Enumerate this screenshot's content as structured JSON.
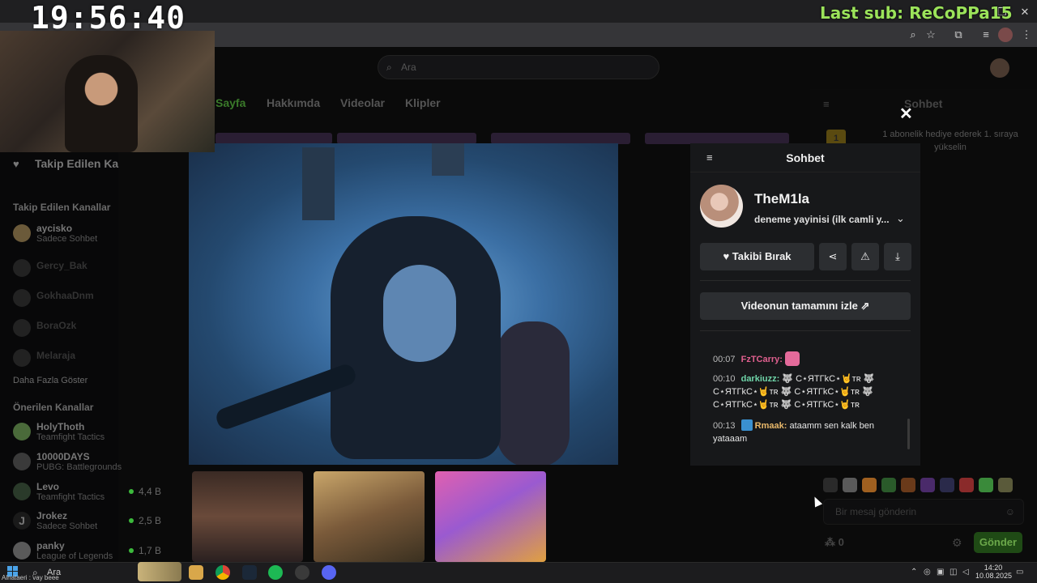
{
  "overlay": {
    "clock": "19:56:40",
    "last_sub": "Last sub: ReCoPPa15"
  },
  "site": {
    "search_placeholder": "Ara",
    "nav_tabs": [
      "Sayfa",
      "Hakkımda",
      "Videolar",
      "Klipler"
    ],
    "sidebar": {
      "title": "Takip Edilen Ka",
      "followed_header": "Takip Edilen Kanallar",
      "followed": [
        {
          "name": "aycisko",
          "sub": "Sadece Sohbet"
        },
        {
          "name": "Gercy_Bak",
          "sub": ""
        },
        {
          "name": "GokhaaDnm",
          "sub": ""
        },
        {
          "name": "BoraOzk",
          "sub": ""
        },
        {
          "name": "Melaraja",
          "sub": ""
        }
      ],
      "show_more": "Daha Fazla Göster",
      "recommended_header": "Önerilen Kanallar",
      "recommended": [
        {
          "name": "HolyThoth",
          "sub": "Teamfight Tactics",
          "viewers": ""
        },
        {
          "name": "10000DAYS",
          "sub": "PUBG: Battlegrounds",
          "viewers": ""
        },
        {
          "name": "Levo",
          "sub": "Teamfight Tactics",
          "viewers": "4,4 B"
        },
        {
          "name": "Jrokez",
          "sub": "Sadece Sohbet",
          "viewers": "2,5 B"
        },
        {
          "name": "panky",
          "sub": "League of Legends",
          "viewers": "1,7 B"
        }
      ]
    },
    "right_chat": {
      "title": "Sohbet",
      "sub_badge": "1",
      "sub_banner": "1 abonelik hediye ederek 1. sıraya yükselin",
      "input_placeholder": "Bir mesaj gönderin",
      "points": "0",
      "send_label": "Gönder"
    }
  },
  "panel": {
    "title": "Sohbet",
    "streamer": "TheM1la",
    "stream_title": "deneme yayinisi (ilk camli y...",
    "unfollow_label": "Takibi Bırak",
    "watch_full_label": "Videonun tamamını izle",
    "messages": [
      {
        "time": "00:07",
        "user": "FzTCarry",
        "color": "#e0608f",
        "text": ""
      },
      {
        "time": "00:10",
        "user": "darkiuzz",
        "color": "#6fd4a8",
        "text": "🐺 C⋆ЯTΓkC⋆🤘ᴛʀ 🐺 C⋆ЯTΓkC⋆🤘ᴛʀ 🐺 C⋆ЯTΓkC⋆🤘ᴛʀ 🐺 C⋆ЯTΓkC⋆🤘ᴛʀ 🐺 C⋆ЯTΓkC⋆🤘ᴛʀ"
      },
      {
        "time": "00:13",
        "user": "Rmaak",
        "color": "#e8b86a",
        "text": "ataamm sen kalk ben yataaam"
      }
    ]
  },
  "taskbar": {
    "search": "Ara",
    "overlay_text": "Alnataeri : vay beee",
    "time": "14:20",
    "date": "10.08.2025"
  }
}
